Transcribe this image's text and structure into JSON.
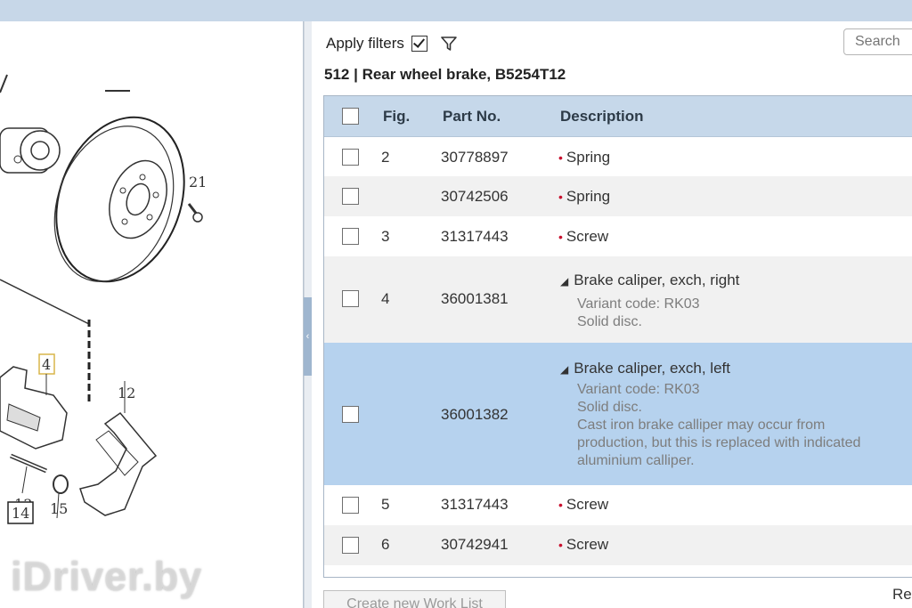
{
  "filters": {
    "apply_label": "Apply filters",
    "checked": true
  },
  "search": {
    "placeholder": "Search"
  },
  "group": {
    "title": "512  |  Rear wheel brake, B5254T12"
  },
  "table": {
    "headers": {
      "fig": "Fig.",
      "part_no": "Part No.",
      "description": "Description"
    },
    "rows": [
      {
        "fig": "2",
        "part_no": "30778897",
        "description": "Spring"
      },
      {
        "fig": "",
        "part_no": "30742506",
        "description": "Spring"
      },
      {
        "fig": "3",
        "part_no": "31317443",
        "description": "Screw"
      },
      {
        "fig": "4",
        "part_no": "36001381",
        "description": "Brake caliper, exch, right",
        "details": [
          "Variant code: RK03",
          "Solid disc."
        ]
      },
      {
        "fig": "",
        "part_no": "36001382",
        "description": "Brake caliper, exch, left",
        "details": [
          "Variant code: RK03",
          "Solid disc.",
          "Cast iron brake calliper may occur from",
          "production, but this is replaced with indicated",
          "aluminium calliper."
        ],
        "selected": true
      },
      {
        "fig": "5",
        "part_no": "31317443",
        "description": "Screw"
      },
      {
        "fig": "6",
        "part_no": "30742941",
        "description": "Screw"
      }
    ]
  },
  "buttons": {
    "create_work_list": "Create new Work List",
    "right_partial": "Re"
  },
  "diagram": {
    "labels": [
      "21",
      "4",
      "12",
      "13",
      "14",
      "15"
    ]
  },
  "watermark": "iDriver.by",
  "colors": {
    "header_bg": "#c6d8ea",
    "selected_row": "#b6d2ee",
    "bullet": "#c8102e"
  }
}
